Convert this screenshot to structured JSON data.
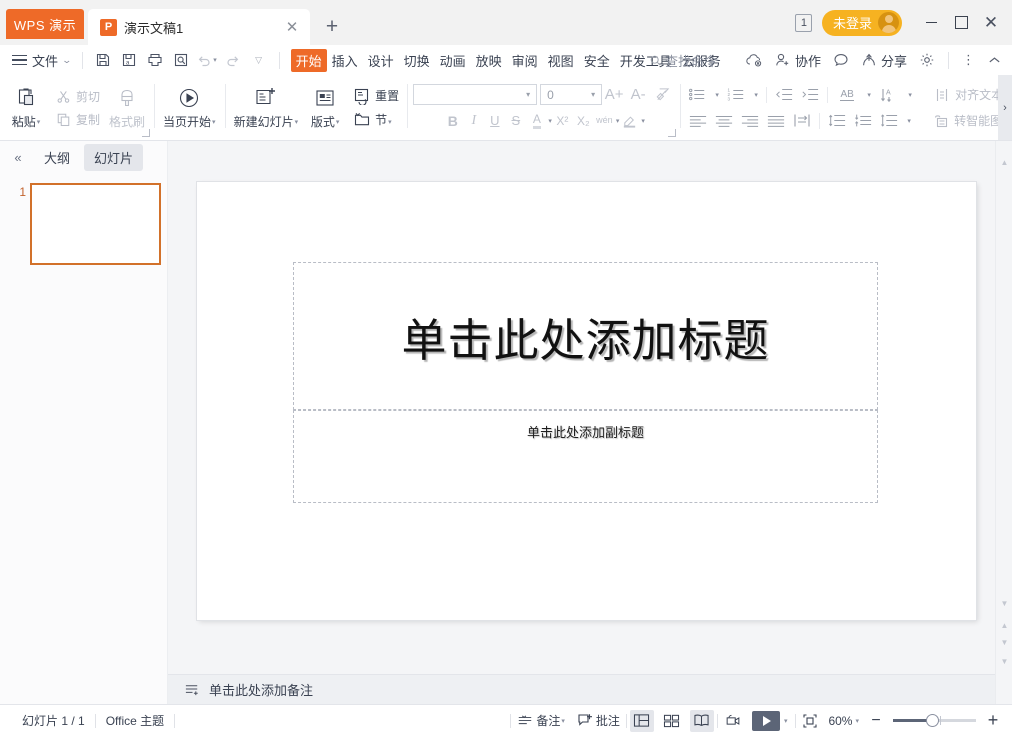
{
  "titlebar": {
    "app_badge": "WPS 演示",
    "tab_title": "演示文稿1",
    "tab_icon_letter": "P",
    "close_tab": "✕",
    "new_tab": "+",
    "doc_count": "1",
    "login_label": "未登录",
    "minimize": "",
    "maximize": "",
    "close": "✕"
  },
  "menubar": {
    "file_label": "文件",
    "quick_access": [
      "save-icon",
      "save-as-icon",
      "print-icon",
      "print-preview-icon",
      "undo-icon",
      "redo-icon",
      "customize-icon"
    ],
    "tabs": [
      {
        "label": "开始",
        "active": true
      },
      {
        "label": "插入",
        "active": false
      },
      {
        "label": "设计",
        "active": false
      },
      {
        "label": "切换",
        "active": false
      },
      {
        "label": "动画",
        "active": false
      },
      {
        "label": "放映",
        "active": false
      },
      {
        "label": "审阅",
        "active": false
      },
      {
        "label": "视图",
        "active": false
      },
      {
        "label": "安全",
        "active": false
      },
      {
        "label": "开发工具",
        "active": false
      },
      {
        "label": "云服务",
        "active": false
      }
    ],
    "search_placeholder": "查找命令",
    "cloud_label": "",
    "collab_label": "协作",
    "comment_label": "",
    "share_label": "分享",
    "settings_label": "",
    "more_label": "",
    "collapse_label": ""
  },
  "ribbon": {
    "paste": "粘贴",
    "cut": "剪切",
    "copy": "复制",
    "format_painter": "格式刷",
    "start_from_current": "当页开始",
    "new_slide": "新建幻灯片",
    "layout": "版式",
    "reset": "重置",
    "section": "节",
    "font_name": "",
    "font_size": "0",
    "grow_font": "A+",
    "shrink_font": "A-",
    "clear_format": "clear-format-icon",
    "bold": "B",
    "italic": "I",
    "underline": "U",
    "strikethrough": "S",
    "font_color": "A",
    "superscript": "X²",
    "subscript": "X₂",
    "pinyin": "wén",
    "highlight": "highlight-icon",
    "bullets": "bullets-icon",
    "numbering": "numbering-icon",
    "decrease_indent": "decrease-indent-icon",
    "increase_indent": "increase-indent-icon",
    "text_direction": "AB",
    "align_text_vertical": "text-direction-icon",
    "align_text": "对齐文本",
    "align_left": "align-left-icon",
    "align_center": "align-center-icon",
    "align_right": "align-right-icon",
    "align_justify": "align-justify-icon",
    "distribute": "distribute-icon",
    "line_spacing1": "line-space-icon",
    "line_spacing2": "paragraph-space-icon",
    "line_spacing3": "line-height-icon",
    "smart_graphic": "转智能图"
  },
  "left_panel": {
    "collapse_icon": "«",
    "tab_outline": "大纲",
    "tab_slides": "幻灯片",
    "slides": [
      {
        "number": "1",
        "selected": true
      }
    ]
  },
  "slide": {
    "title_placeholder": "单击此处添加标题",
    "subtitle_placeholder": "单击此处添加副标题"
  },
  "notes": {
    "placeholder": "单击此处添加备注"
  },
  "statusbar": {
    "slide_counter": "幻灯片 1 / 1",
    "theme": "Office 主题",
    "notes_btn": "备注",
    "comment_btn": "批注",
    "view_normal": "normal-view-icon",
    "view_sorter": "slide-sorter-icon",
    "view_reading": "reading-view-icon",
    "record_btn": "record-icon",
    "play_btn": "play-icon",
    "fit_btn": "fit-to-window-icon",
    "zoom_level": "60%",
    "zoom_out": "−",
    "zoom_in": "+"
  },
  "colors": {
    "brand_orange": "#ee6a28",
    "login_yellow": "#f6b221",
    "thumb_border": "#d2712a",
    "ui_text": "#3a4252",
    "play_button": "#5c6577"
  }
}
